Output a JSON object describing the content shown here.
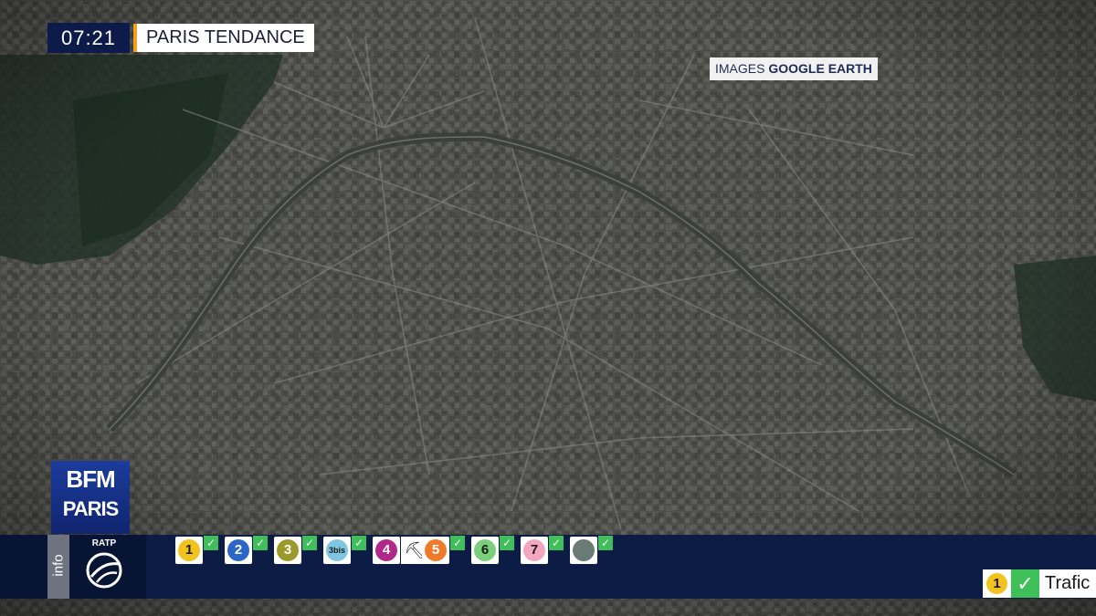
{
  "overlay": {
    "clock": "07:21",
    "show_title": "PARIS TENDANCE",
    "credit_prefix": "IMAGES",
    "credit_source": "GOOGLE EARTH"
  },
  "logo": {
    "line1": "BFM",
    "line2": "PARIS"
  },
  "ticker": {
    "info_label": "info",
    "ratp_label": "RATP",
    "lines": [
      {
        "label": "1",
        "color": "#f2c21e",
        "text_color": "#1a1a1a",
        "status_icon": "check-icon"
      },
      {
        "label": "2",
        "color": "#2a67c9",
        "text_color": "#ffffff",
        "status_icon": "check-icon"
      },
      {
        "label": "3",
        "color": "#9a9a2a",
        "text_color": "#ffffff",
        "status_icon": "check-icon"
      },
      {
        "label": "3bis",
        "color": "#7fc6e0",
        "text_color": "#1a1a1a",
        "status_icon": "check-icon"
      },
      {
        "label": "4",
        "color": "#b0298a",
        "text_color": "#ffffff",
        "status_icon": "works-icon"
      },
      {
        "label": "5",
        "color": "#f07a2a",
        "text_color": "#ffffff",
        "status_icon": "check-icon"
      },
      {
        "label": "6",
        "color": "#7ccf7a",
        "text_color": "#1a1a1a",
        "status_icon": "check-icon"
      },
      {
        "label": "7",
        "color": "#f2a6c0",
        "text_color": "#1a1a1a",
        "status_icon": "check-icon"
      },
      {
        "label": "",
        "color": "#6a7a74",
        "text_color": "#ffffff",
        "status_icon": "check-icon"
      }
    ],
    "traffic": {
      "line_label": "1",
      "text": "Trafic"
    }
  }
}
